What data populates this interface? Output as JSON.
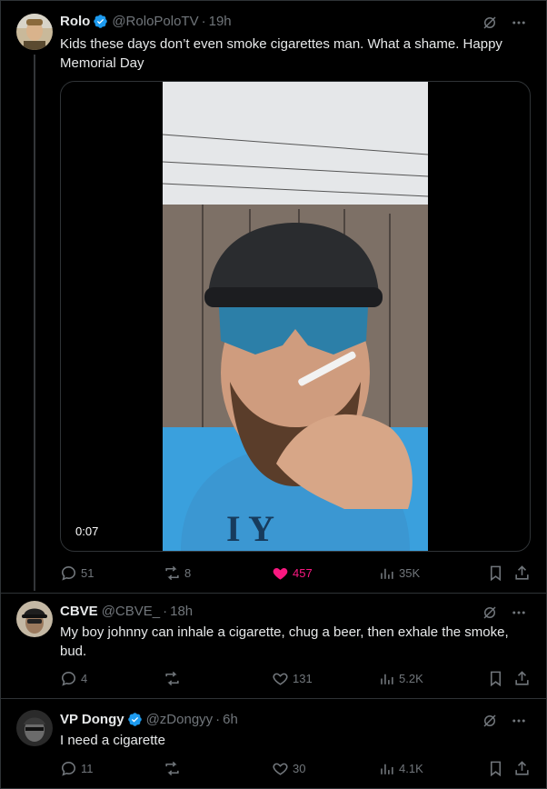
{
  "posts": [
    {
      "name": "Rolo",
      "handle": "@RoloPoloTV",
      "time": "19h",
      "text": "Kids these days don’t even smoke cigarettes man. What a shame. Happy Memorial Day",
      "media": {
        "duration": "0:07"
      },
      "replies": "51",
      "reposts": "8",
      "likes": "457",
      "views": "35K",
      "liked": true
    },
    {
      "name": "CBVE",
      "handle": "@CBVE_",
      "time": "18h",
      "text": "My boy johnny can inhale a cigarette, chug a beer, then exhale the smoke, bud.",
      "replies": "4",
      "reposts": "",
      "likes": "131",
      "views": "5.2K",
      "liked": false
    },
    {
      "name": "VP Dongy",
      "handle": "@zDongyy",
      "time": "6h",
      "text": "I need a cigarette",
      "replies": "11",
      "reposts": "",
      "likes": "30",
      "views": "4.1K",
      "liked": false
    }
  ],
  "ui": {
    "dot": "·"
  },
  "colors": {
    "accent": "#1d9bf0",
    "like": "#f91880",
    "muted": "#71767b",
    "text": "#e7e9ea",
    "border": "#2f3336"
  },
  "icons": [
    "verified-badge-icon",
    "grok-icon",
    "more-icon",
    "reply-icon",
    "repost-icon",
    "like-icon",
    "views-icon",
    "bookmark-icon",
    "share-icon"
  ]
}
